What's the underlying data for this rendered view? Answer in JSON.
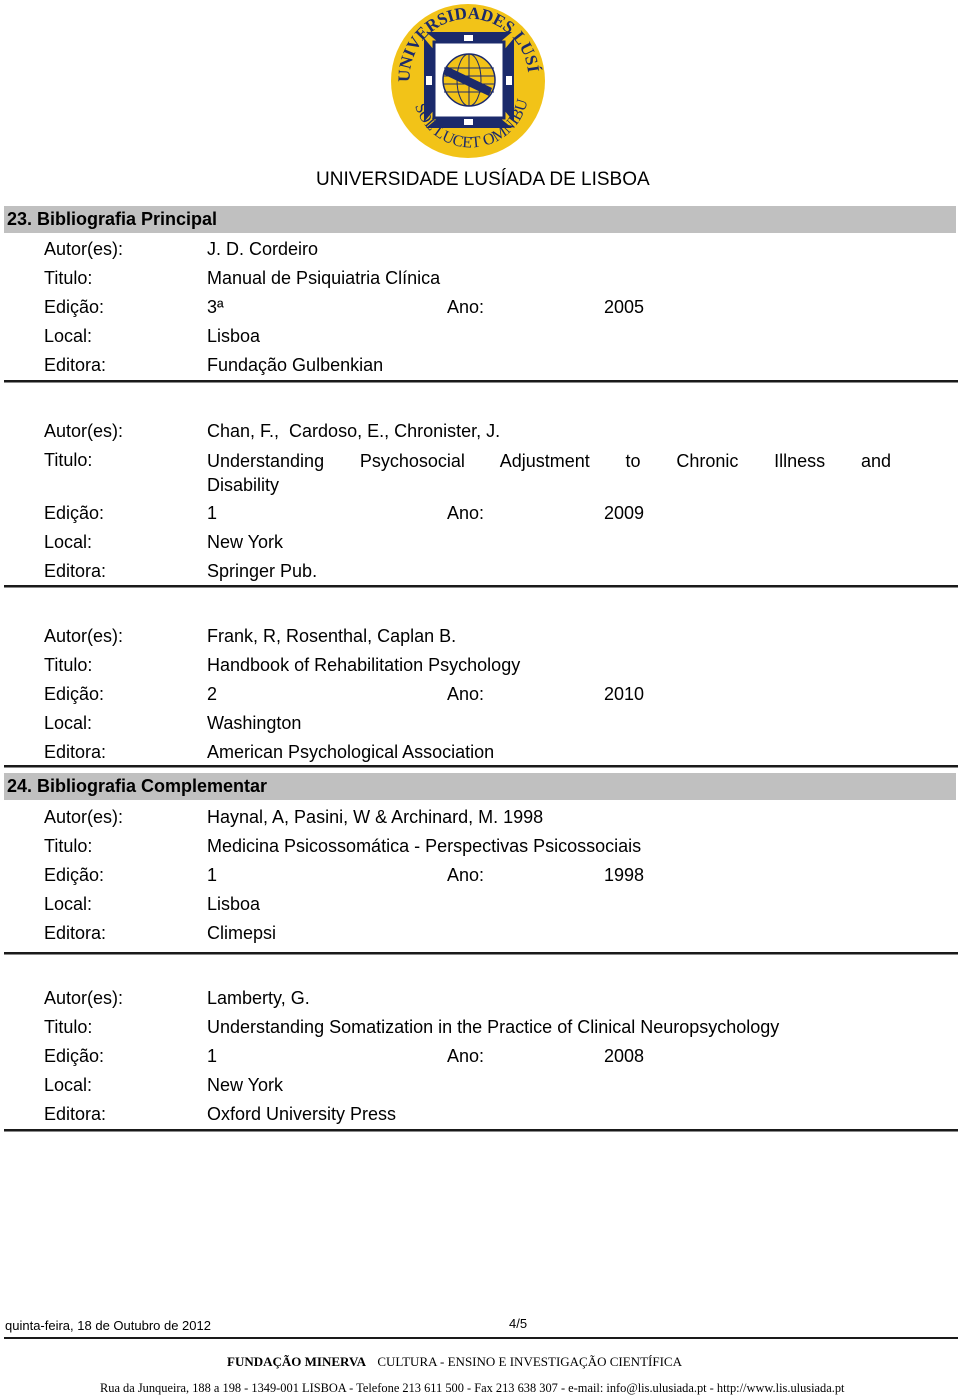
{
  "header": {
    "logo": {
      "name": "universidades-lusiada-seal",
      "ring_text_top": "UNIVERSIDADES LUSÍADA",
      "ring_text_bottom": "SOL LUCET OMNIBUS",
      "colors": {
        "ring": "#f2c318",
        "navy": "#1b2a6b",
        "inner": "#ffffff"
      }
    },
    "university_name": "UNIVERSIDADE LUSÍADA DE LISBOA"
  },
  "labels": {
    "authors": "Autor(es):",
    "title": "Titulo:",
    "edition": "Edição:",
    "year": "Ano:",
    "place": "Local:",
    "publisher": "Editora:"
  },
  "sections": [
    {
      "heading": "23. Bibliografia Principal",
      "entries": [
        {
          "authors": "J. D. Cordeiro",
          "title": "Manual de Psiquiatria Clínica",
          "edition": "3ª",
          "year": "2005",
          "place": "Lisboa",
          "publisher": "Fundação Gulbenkian"
        },
        {
          "authors": "Chan, F.,  Cardoso, E., Chronister, J.",
          "title_line1": "Understanding Psychosocial Adjustment to Chronic Illness and",
          "title_line2": "Disability",
          "edition": "1",
          "year": "2009",
          "place": "New York",
          "publisher": "Springer Pub."
        },
        {
          "authors": "Frank, R, Rosenthal, Caplan B.",
          "title": "Handbook of Rehabilitation Psychology",
          "edition": "2",
          "year": "2010",
          "place": "Washington",
          "publisher": "American Psychological Association"
        }
      ]
    },
    {
      "heading": "24. Bibliografia Complementar",
      "entries": [
        {
          "authors": "Haynal, A, Pasini, W & Archinard, M. 1998",
          "title": "Medicina Psicossomática - Perspectivas Psicossociais",
          "edition": "1",
          "year": "1998",
          "place": "Lisboa",
          "publisher": "Climepsi"
        },
        {
          "authors": "Lamberty, G.",
          "title": "Understanding Somatization in the Practice of Clinical Neuropsychology",
          "edition": "1",
          "year": "2008",
          "place": "New York",
          "publisher": "Oxford University Press"
        }
      ]
    }
  ],
  "footer": {
    "date": "quinta-feira, 18 de Outubro de 2012",
    "page": "4/5",
    "foundation_name": "FUNDAÇÃO MINERVA",
    "foundation_tagline": "CULTURA - ENSINO E INVESTIGAÇÃO CIENTÍFICA",
    "address": "Rua da Junqueira, 188 a 198 - 1349-001 LISBOA - Telefone 213 611 500 - Fax 213 638 307 - e-mail: info@lis.ulusiada.pt - http://www.lis.ulusiada.pt"
  }
}
